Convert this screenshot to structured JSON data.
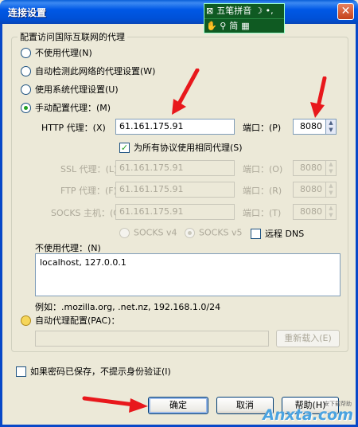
{
  "window": {
    "title": "连接设置",
    "close_glyph": "✕"
  },
  "ime": {
    "row1": "五笔拼音",
    "row1_icons": "☽ •,",
    "row2": "简",
    "row2_icons": "✋ ⚲",
    "row2_tail": "▦"
  },
  "group_title": "配置访问国际互联网的代理",
  "options": {
    "no_proxy": "不使用代理(N)",
    "auto_detect": "自动检测此网络的代理设置(W)",
    "system_proxy": "使用系统代理设置(U)",
    "manual_proxy": "手动配置代理：(M)"
  },
  "http": {
    "label": "HTTP 代理：(X)",
    "host": "61.161.175.91",
    "port_label": "端口：(P)",
    "port": "8080"
  },
  "same_for_all": "为所有协议使用相同代理(S)",
  "ssl": {
    "label": "SSL 代理：(L)",
    "host": "61.161.175.91",
    "port_label": "端口：(O)",
    "port": "8080"
  },
  "ftp": {
    "label": "FTP 代理：(F)",
    "host": "61.161.175.91",
    "port_label": "端口：(R)",
    "port": "8080"
  },
  "socks": {
    "label": "SOCKS 主机：(C)",
    "host": "61.161.175.91",
    "port_label": "端口：(T)",
    "port": "8080"
  },
  "socks_version": {
    "v4": "SOCKS v4",
    "v5": "SOCKS v5",
    "remote_dns": "远程 DNS"
  },
  "no_proxy_for": {
    "label": "不使用代理：(N)",
    "value": "localhost, 127.0.0.1",
    "example": "例如：.mozilla.org, .net.nz, 192.168.1.0/24"
  },
  "pac": {
    "label": "自动代理配置(PAC)：",
    "url": "",
    "reload": "重新载入(E)"
  },
  "no_auth_prompt": "如果密码已保存，不提示身份验证(I)",
  "buttons": {
    "ok": "确定",
    "cancel": "取消",
    "help": "帮助(H)"
  },
  "watermark": {
    "main": "Anxta.com",
    "sub": "安下载帮助"
  },
  "colors": {
    "arrow": "#e8181c",
    "titlebar": "#0058e6"
  }
}
